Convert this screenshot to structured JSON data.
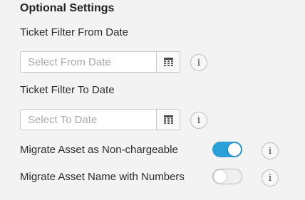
{
  "section": {
    "title": "Optional Settings"
  },
  "from_date": {
    "label": "Ticket Filter From Date",
    "placeholder": "Select From Date",
    "value": ""
  },
  "to_date": {
    "label": "Ticket Filter To Date",
    "placeholder": "Select To Date",
    "value": ""
  },
  "toggles": [
    {
      "label": "Migrate Asset as Non-chargeable",
      "on": true
    },
    {
      "label": "Migrate Asset Name with Numbers",
      "on": false
    }
  ],
  "info_glyph": "i",
  "icons": {
    "calendar": "calendar-icon",
    "info": "info-icon"
  },
  "colors": {
    "background": "#f3f3f3",
    "toggle_on": "#2a9fd8",
    "toggle_off": "#f0f0f0"
  }
}
